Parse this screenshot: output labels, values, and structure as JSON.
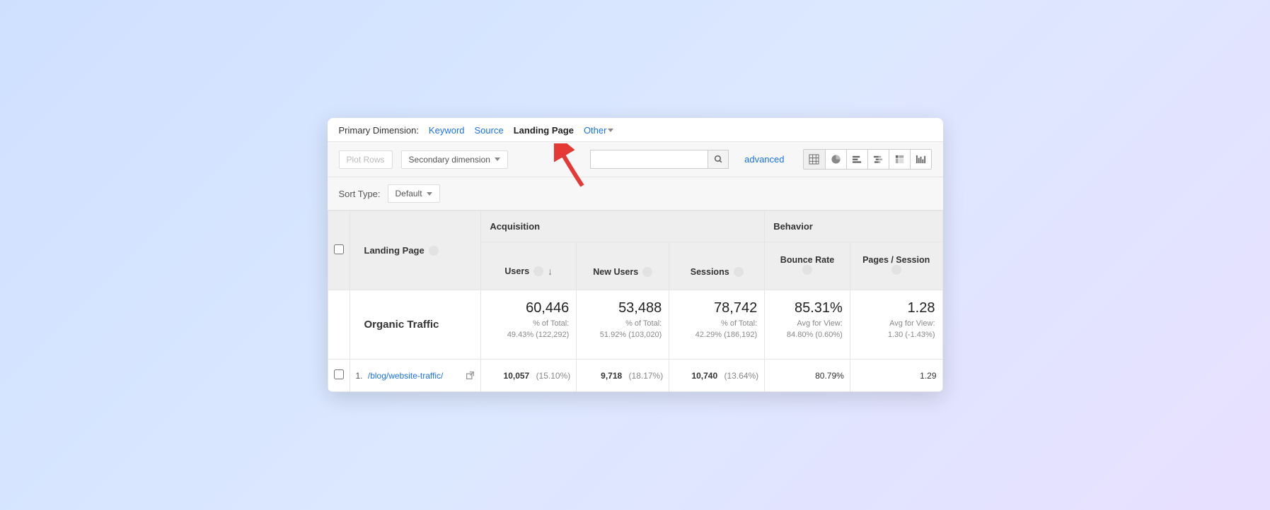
{
  "primary_dimension": {
    "label": "Primary Dimension:",
    "keyword": "Keyword",
    "source": "Source",
    "landing_page": "Landing Page",
    "other": "Other"
  },
  "toolbar": {
    "plot_rows": "Plot Rows",
    "secondary_dim": "Secondary dimension",
    "advanced": "advanced",
    "search_placeholder": ""
  },
  "sort": {
    "label": "Sort Type:",
    "value": "Default"
  },
  "table": {
    "lp_header": "Landing Page",
    "group_acq": "Acquisition",
    "group_beh": "Behavior",
    "metrics": {
      "users": "Users",
      "new_users": "New Users",
      "sessions": "Sessions",
      "bounce": "Bounce Rate",
      "pps": "Pages / Session"
    },
    "totals": {
      "segment": "Organic Traffic",
      "users": {
        "big": "60,446",
        "sub1": "% of Total:",
        "sub2": "49.43% (122,292)"
      },
      "new_users": {
        "big": "53,488",
        "sub1": "% of Total:",
        "sub2": "51.92% (103,020)"
      },
      "sessions": {
        "big": "78,742",
        "sub1": "% of Total:",
        "sub2": "42.29% (186,192)"
      },
      "bounce": {
        "big": "85.31%",
        "sub1": "Avg for View:",
        "sub2": "84.80% (0.60%)"
      },
      "pps": {
        "big": "1.28",
        "sub1": "Avg for View:",
        "sub2": "1.30 (-1.43%)"
      }
    },
    "rows": [
      {
        "idx": "1.",
        "lp": "/blog/website-traffic/",
        "users": "10,057",
        "users_pct": "(15.10%)",
        "new_users": "9,718",
        "new_users_pct": "(18.17%)",
        "sessions": "10,740",
        "sessions_pct": "(13.64%)",
        "bounce": "80.79%",
        "pps": "1.29"
      }
    ]
  }
}
